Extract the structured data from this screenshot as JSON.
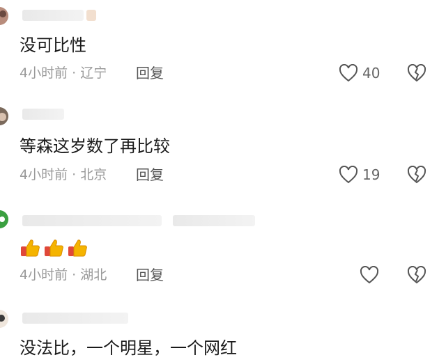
{
  "comments": [
    {
      "text": "没可比性",
      "time": "4小时前",
      "location": "辽宁",
      "reply_label": "回复",
      "likes": "40"
    },
    {
      "text": "等森这岁数了再比较",
      "time": "4小时前",
      "location": "北京",
      "reply_label": "回复",
      "likes": "19"
    },
    {
      "text": "",
      "emoji": [
        "thumbs-up",
        "thumbs-up",
        "thumbs-up"
      ],
      "time": "4小时前",
      "location": "湖北",
      "reply_label": "回复",
      "likes": ""
    },
    {
      "text": "没法比，一个明星，一个网红"
    }
  ],
  "separator": "·",
  "colors": {
    "meta": "#9a9a9a",
    "icon": "#555555",
    "thumb": "#f5b400",
    "thumb_cuff": "#e0483a"
  },
  "icons": {
    "like": "heart-outline-icon",
    "dislike": "broken-heart-icon"
  }
}
